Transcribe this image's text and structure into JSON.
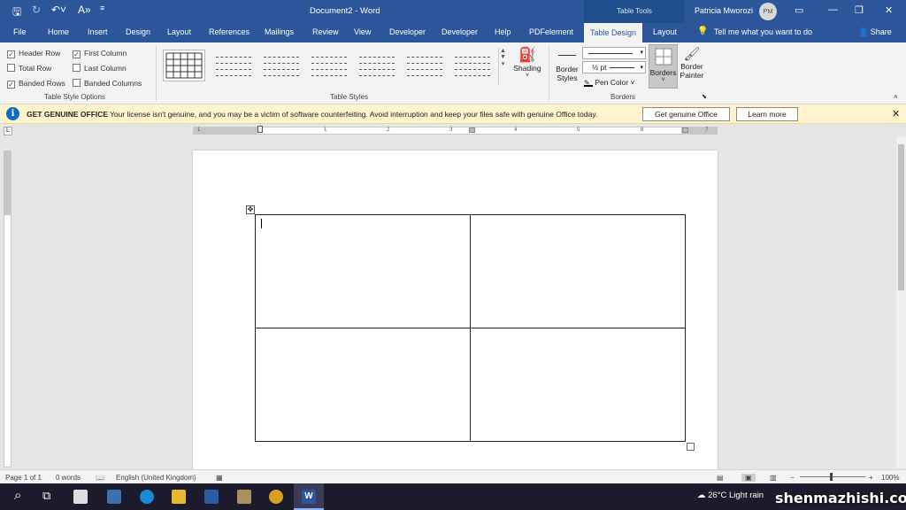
{
  "titlebar": {
    "document_title": "Document2  -  Word",
    "contextual_group": "Table Tools",
    "user_name": "Patricia Mworozi",
    "user_initials": "PM"
  },
  "tabs": [
    "File",
    "Home",
    "Insert",
    "Design",
    "Layout",
    "References",
    "Mailings",
    "Review",
    "View",
    "Developer",
    "Developer",
    "Help",
    "PDFelement",
    "Table Design",
    "Layout"
  ],
  "tell_me": "Tell me what you want to do",
  "share": "Share",
  "ribbon": {
    "style_options": {
      "header_row": {
        "label": "Header Row",
        "checked": true
      },
      "total_row": {
        "label": "Total Row",
        "checked": false
      },
      "banded_rows": {
        "label": "Banded Rows",
        "checked": true
      },
      "first_column": {
        "label": "First Column",
        "checked": true
      },
      "last_column": {
        "label": "Last Column",
        "checked": false
      },
      "banded_columns": {
        "label": "Banded Columns",
        "checked": false
      },
      "group_label": "Table Style Options"
    },
    "table_styles_label": "Table Styles",
    "shading_label": "Shading",
    "border_styles_label1": "Border",
    "border_styles_label2": "Styles",
    "pen_weight": "½ pt",
    "pen_color": "Pen Color",
    "borders_label": "Borders",
    "border_painter_label1": "Border",
    "border_painter_label2": "Painter",
    "borders_group_label": "Borders"
  },
  "banner": {
    "title": "GET GENUINE OFFICE",
    "message": "Your license isn't genuine, and you may be a victim of software counterfeiting. Avoid interruption and keep your files safe with genuine Office today.",
    "primary_button": "Get genuine Office",
    "secondary_button": "Learn more"
  },
  "ruler_numbers": [
    "1",
    "1",
    "2",
    "3",
    "4",
    "5",
    "6",
    "7"
  ],
  "status": {
    "page": "Page 1 of 1",
    "words": "0 words",
    "language": "English (United Kingdom)",
    "zoom": "100%"
  },
  "taskbar": {
    "weather": "26°C  Light rain",
    "watermark": "shenmazhishi.com"
  },
  "colors": {
    "brand": "#2b579a",
    "banner_bg": "#fff4ce",
    "info_blue": "#0f6cbd"
  }
}
